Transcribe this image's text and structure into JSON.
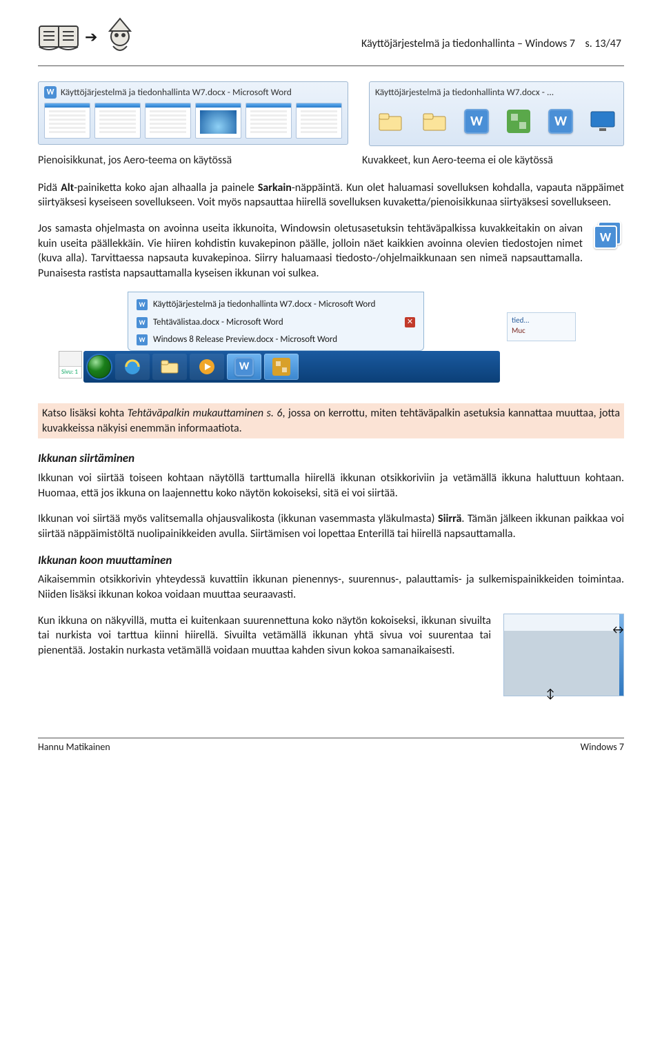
{
  "header": {
    "title": "Käyttöjärjestelmä ja tiedonhallinta – Windows 7",
    "page": "s. 13/47"
  },
  "screenshot_a": {
    "titlebar": "Käyttöjärjestelmä ja tiedonhallinta W7.docx - Microsoft Word"
  },
  "screenshot_b": {
    "titlebar": "Käyttöjärjestelmä ja tiedonhallinta W7.docx - ..."
  },
  "captions": {
    "left": "Pienoisikkunat, jos Aero-teema on käytössä",
    "right": "Kuvakkeet, kun Aero-teema ei ole käytössä"
  },
  "para1_a": "Pidä ",
  "para1_bold1": "Alt",
  "para1_b": "-painiketta koko ajan alhaalla ja painele ",
  "para1_bold2": "Sarkain",
  "para1_c": "-näppäintä. Kun olet haluamasi sovelluksen kohdalla, vapauta näppäimet siirtyäksesi kyseiseen sovellukseen. Voit myös napsauttaa hiirellä sovelluksen kuvaketta/pienoisikkunaa siirtyäksesi sovellukseen.",
  "para2": "Jos samasta ohjelmasta on avoinna useita ikkunoita, Windowsin oletusasetuksin tehtäväpalkissa kuvakkeitakin on aivan kuin useita päällekkäin. Vie hiiren kohdistin kuvakepinon päälle, jolloin näet kaikkien avoinna olevien tiedostojen nimet (kuva alla). Tarvittaessa napsauta kuvakepinoa. Siirry haluamaasi tiedosto-/ohjelmaikkunaan sen nimeä napsauttamalla. Punaisesta rastista napsauttamalla kyseisen ikkunan voi sulkea.",
  "jumplist": {
    "items": [
      "Käyttöjärjestelmä ja tiedonhallinta W7.docx - Microsoft Word",
      "Tehtävälistaa.docx - Microsoft Word",
      "Windows 8 Release Preview.docx - Microsoft Word"
    ],
    "slip_a": "tied...",
    "slip_b": "Muc"
  },
  "statusbar": {
    "sivu": "Sivu: 1"
  },
  "highlight_a": "Katso lisäksi kohta ",
  "highlight_italic": "Tehtäväpalkin mukauttaminen s. 6",
  "highlight_b": ", jossa on kerrottu, miten tehtäväpalkin asetuksia kannattaa muuttaa, jotta kuvakkeissa näkyisi enemmän informaatiota.",
  "h_move": "Ikkunan siirtäminen",
  "move_p1": "Ikkunan voi siirtää toiseen kohtaan näytöllä tarttumalla hiirellä ikkunan otsikkoriviin ja vetämällä ikkuna haluttuun kohtaan. Huomaa, että jos ikkuna on laajennettu koko näytön kokoiseksi, sitä ei voi siirtää.",
  "move_p2_a": "Ikkunan voi siirtää myös valitsemalla ohjausvalikosta (ikkunan vasemmasta yläkulmasta) ",
  "move_p2_bold": "Siirrä",
  "move_p2_b": ". Tämän jälkeen ikkunan paikkaa voi siirtää näppäimistöltä nuolipainikkeiden avulla. Siirtämisen voi lopettaa Enterillä tai hiirellä napsauttamalla.",
  "h_resize": "Ikkunan koon muuttaminen",
  "resize_p1": "Aikaisemmin otsikkorivin yhteydessä kuvattiin ikkunan pienennys-, suurennus-, palauttamis- ja sulkemispainikkeiden toimintaa. Niiden lisäksi ikkunan kokoa voidaan muuttaa seuraavasti.",
  "resize_p2": "Kun ikkuna on näkyvillä, mutta ei kuitenkaan suurennettuna koko näytön kokoiseksi, ikkunan sivuilta tai nurkista voi tarttua kiinni hiirellä. Sivuilta vetämällä ikkunan yhtä sivua voi suurentaa tai pienentää. Jostakin nurkasta vetämällä voidaan muuttaa kahden sivun kokoa samanaikaisesti.",
  "footer": {
    "author": "Hannu Matikainen",
    "os": "Windows 7"
  }
}
